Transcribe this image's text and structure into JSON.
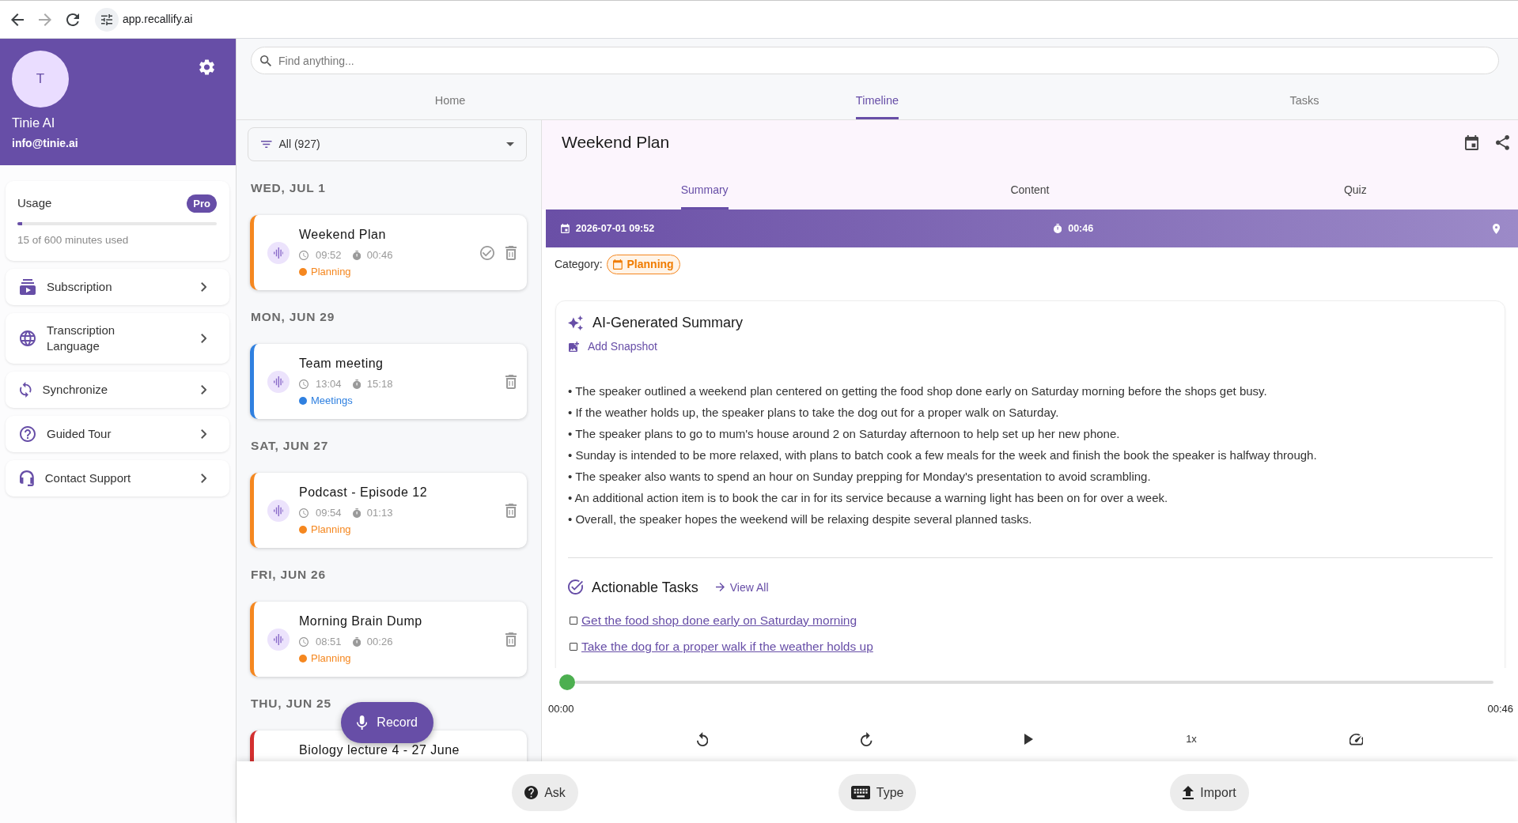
{
  "browser": {
    "url": "app.recallify.ai",
    "forward_disabled": true
  },
  "sidebar": {
    "profile": {
      "initial": "T",
      "name": "Tinie AI",
      "email": "info@tinie.ai"
    },
    "usage": {
      "label": "Usage",
      "plan": "Pro",
      "level": 0.025,
      "caption": "15 of 600 minutes used"
    },
    "menu": [
      {
        "label": "Subscription"
      },
      {
        "label": "Transcription Language"
      },
      {
        "label": "Synchronize"
      },
      {
        "label": "Guided Tour"
      },
      {
        "label": "Contact Support"
      }
    ]
  },
  "search": {
    "placeholder": "Find anything..."
  },
  "tabs": [
    {
      "label": "Home",
      "selected": false
    },
    {
      "label": "Timeline",
      "selected": true
    },
    {
      "label": "Tasks",
      "selected": false
    }
  ],
  "timeline": {
    "filter": "All (927)",
    "groups": [
      {
        "date": "WED, JUL 1",
        "entries": [
          {
            "title": "Weekend Plan",
            "time": "09:52",
            "duration": "00:46",
            "category": "Planning",
            "color": "#f5871f",
            "selected": true
          }
        ]
      },
      {
        "date": "MON, JUN 29",
        "entries": [
          {
            "title": "Team meeting",
            "time": "13:04",
            "duration": "15:18",
            "category": "Meetings",
            "color": "#2f80e0",
            "selected": false
          }
        ]
      },
      {
        "date": "SAT, JUN 27",
        "entries": [
          {
            "title": "Podcast - Episode 12",
            "time": "09:54",
            "duration": "01:13",
            "category": "Planning",
            "color": "#f5871f",
            "selected": false
          }
        ]
      },
      {
        "date": "FRI, JUN 26",
        "entries": [
          {
            "title": "Morning Brain Dump",
            "time": "08:51",
            "duration": "00:26",
            "category": "Planning",
            "color": "#f5871f",
            "selected": false
          }
        ]
      },
      {
        "date": "THU, JUN 25",
        "entries": [
          {
            "title": "Biology lecture 4 - 27 June",
            "color": "#d32f2f"
          }
        ]
      }
    ],
    "record_button": "Record"
  },
  "detail": {
    "title": "Weekend Plan",
    "tabs": [
      {
        "label": "Summary",
        "selected": true
      },
      {
        "label": "Content",
        "selected": false
      },
      {
        "label": "Quiz",
        "selected": false
      }
    ],
    "info": {
      "date": "2026-07-01 09:52",
      "duration": "00:46"
    },
    "category": {
      "label": "Category:",
      "value": "Planning"
    },
    "summary": {
      "title": "AI-Generated Summary",
      "action": "Add Snapshot",
      "bullets": [
        "• The speaker outlined a weekend plan centered on getting the food shop done early on Saturday morning before the shops get busy.",
        "• If the weather holds up, the speaker plans to take the dog out for a proper walk on Saturday.",
        "• The speaker plans to go to mum's house around 2 on Saturday afternoon to help set up her new phone.",
        "• Sunday is intended to be more relaxed, with plans to batch cook a few meals for the week and finish the book the speaker is halfway through.",
        "• The speaker also wants to spend an hour on Sunday prepping for Monday's presentation to avoid scrambling.",
        "• An additional action item is to book the car in for its service because a warning light has been on for over a week.",
        "• Overall, the speaker hopes the weekend will be relaxing despite several planned tasks."
      ]
    },
    "tasks": {
      "title": "Actionable Tasks",
      "link": "View All",
      "items": [
        {
          "text": "Get the food shop done early on Saturday morning",
          "checked": false
        },
        {
          "text": "Take the dog for a proper walk if the weather holds up",
          "checked": false
        }
      ]
    },
    "player": {
      "level": 0,
      "elapsed": "00:00",
      "total": "00:46",
      "speed": "1x"
    }
  },
  "bottom_actions": [
    {
      "label": "Ask"
    },
    {
      "label": "Type"
    },
    {
      "label": "Import"
    }
  ]
}
